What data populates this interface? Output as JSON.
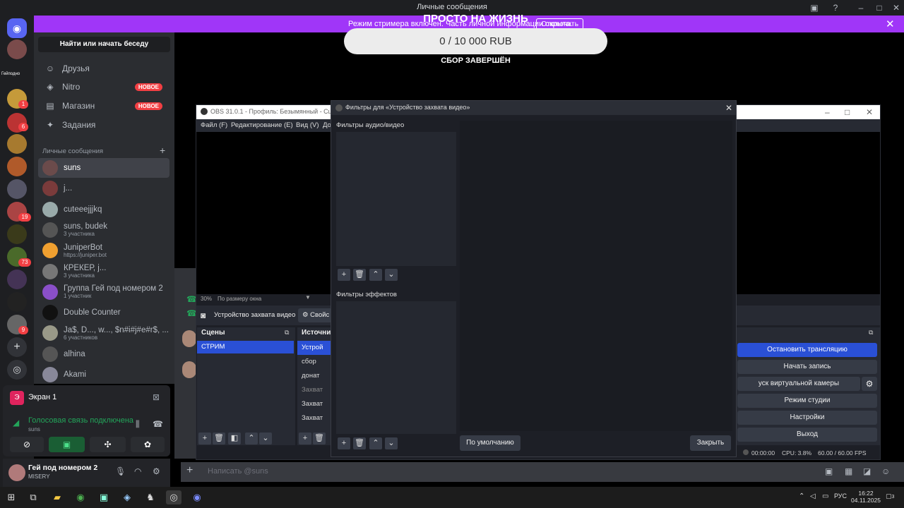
{
  "discord": {
    "title": "Личные сообщения",
    "banner": {
      "text": "Режим стримера включен. Часть личной информации скрыта.",
      "button": "Отключить"
    },
    "search_placeholder": "Найти или начать беседу",
    "nav": [
      {
        "label": "Друзья",
        "icon": "friends-icon"
      },
      {
        "label": "Nitro",
        "icon": "nitro-icon",
        "tag": "НОВОЕ"
      },
      {
        "label": "Магазин",
        "icon": "shop-icon",
        "tag": "НОВОЕ"
      },
      {
        "label": "Задания",
        "icon": "quests-icon"
      }
    ],
    "dm_header": "Личные сообщения",
    "dms": [
      {
        "name": "suns",
        "sub": "",
        "color": "#6b4b4b"
      },
      {
        "name": "j...",
        "sub": "",
        "color": "#7a3b3b"
      },
      {
        "name": "cuteeejjjkq",
        "sub": "",
        "color": "#9aa"
      },
      {
        "name": "suns, budek",
        "sub": "3 участника",
        "color": "#555"
      },
      {
        "name": "JuniperBot",
        "sub": "https://juniper.bot",
        "color": "#f0a030"
      },
      {
        "name": "КРЕКЕР, j...",
        "sub": "3 участника",
        "color": "#777"
      },
      {
        "name": "Группа Гей под номером 2",
        "sub": "1 участник",
        "color": "#8a4fc9"
      },
      {
        "name": "Double Counter",
        "sub": "",
        "color": "#111"
      },
      {
        "name": "Ja$, D..., w..., $n#i#j#e#r$, ...",
        "sub": "6 участников",
        "color": "#998"
      },
      {
        "name": "alhina",
        "sub": "",
        "color": "#555"
      },
      {
        "name": "Akami",
        "sub": "",
        "color": "#889"
      }
    ],
    "server_label": "Гейподно",
    "server_badges": [
      "1",
      "6",
      "19",
      "73",
      "9"
    ],
    "voice": {
      "screen": "Экран 1",
      "status": "Голосовая связь подключена",
      "channel": "suns"
    },
    "user": {
      "name": "Гей под номером 2",
      "status": "MISERY"
    },
    "chat_placeholder": "Написать @suns"
  },
  "stream": {
    "title": "ПРОСТО НА ЖИЗНЬ",
    "progress": "0 / 10 000 RUB",
    "status": "СБОР ЗАВЕРШЁН",
    "progress_fraction": 0
  },
  "obs": {
    "title": "OBS 31.0.1 - Профиль: Безымянный - Сцены: Б...",
    "menu": [
      "Файл (F)",
      "Редактирование (E)",
      "Вид (V)",
      "До"
    ],
    "zoom": "30%",
    "fit": "По размеру окна",
    "source_selected": "Устройство захвата видео",
    "props": "Свойс",
    "scenes_title": "Сцены",
    "scenes": [
      "СТРИМ"
    ],
    "sources_title": "Источни",
    "sources": [
      "Устрой",
      "сбор",
      "донат",
      "Захват",
      "Захват",
      "Захват"
    ],
    "controls": [
      "Остановить трансляцию",
      "Начать запись",
      "уск виртуальной камеры",
      "Режим студии",
      "Настройки",
      "Выход"
    ],
    "status": {
      "time": "00:00:00",
      "cpu": "CPU: 3.8%",
      "fps": "60.00 / 60.00 FPS"
    }
  },
  "filters": {
    "title": "Фильтры для «Устройство захвата видео»",
    "audio_video": "Фильтры аудио/видео",
    "effects": "Фильтры эффектов",
    "defaults": "По умолчанию",
    "close": "Закрыть"
  },
  "taskbar": {
    "lang": "РУС",
    "time": "16:22",
    "date": "04.11.2025",
    "notif": "3"
  }
}
